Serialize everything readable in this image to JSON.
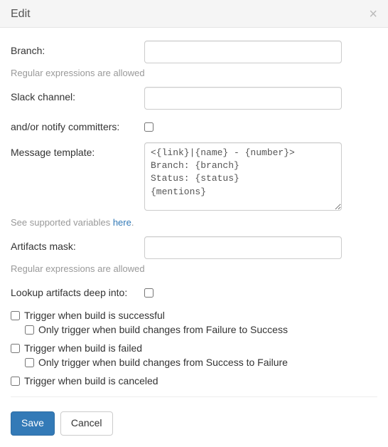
{
  "header": {
    "title": "Edit",
    "close": "×"
  },
  "form": {
    "branch": {
      "label": "Branch:",
      "value": "",
      "placeholder": ""
    },
    "branch_help": "Regular expressions are allowed",
    "slack": {
      "label": "Slack channel:",
      "value": "",
      "placeholder": ""
    },
    "notify": {
      "label": "and/or notify committers:",
      "checked": false
    },
    "template": {
      "label": "Message template:",
      "value": "<{link}|{name} - {number}>\nBranch: {branch}\nStatus: {status}\n{mentions}"
    },
    "template_help_prefix": "See supported variables ",
    "template_help_link": "here",
    "template_help_suffix": ".",
    "artifacts": {
      "label": "Artifacts mask:",
      "value": "",
      "placeholder": ""
    },
    "artifacts_help": "Regular expressions are allowed",
    "lookup": {
      "label": "Lookup artifacts deep into:",
      "checked": false
    },
    "triggers": {
      "success": {
        "label": "Trigger when build is successful",
        "checked": false,
        "sub": {
          "label": "Only trigger when build changes from Failure to Success",
          "checked": false
        }
      },
      "failed": {
        "label": "Trigger when build is failed",
        "checked": false,
        "sub": {
          "label": "Only trigger when build changes from Success to Failure",
          "checked": false
        }
      },
      "canceled": {
        "label": "Trigger when build is canceled",
        "checked": false
      }
    }
  },
  "footer": {
    "save": "Save",
    "cancel": "Cancel"
  }
}
